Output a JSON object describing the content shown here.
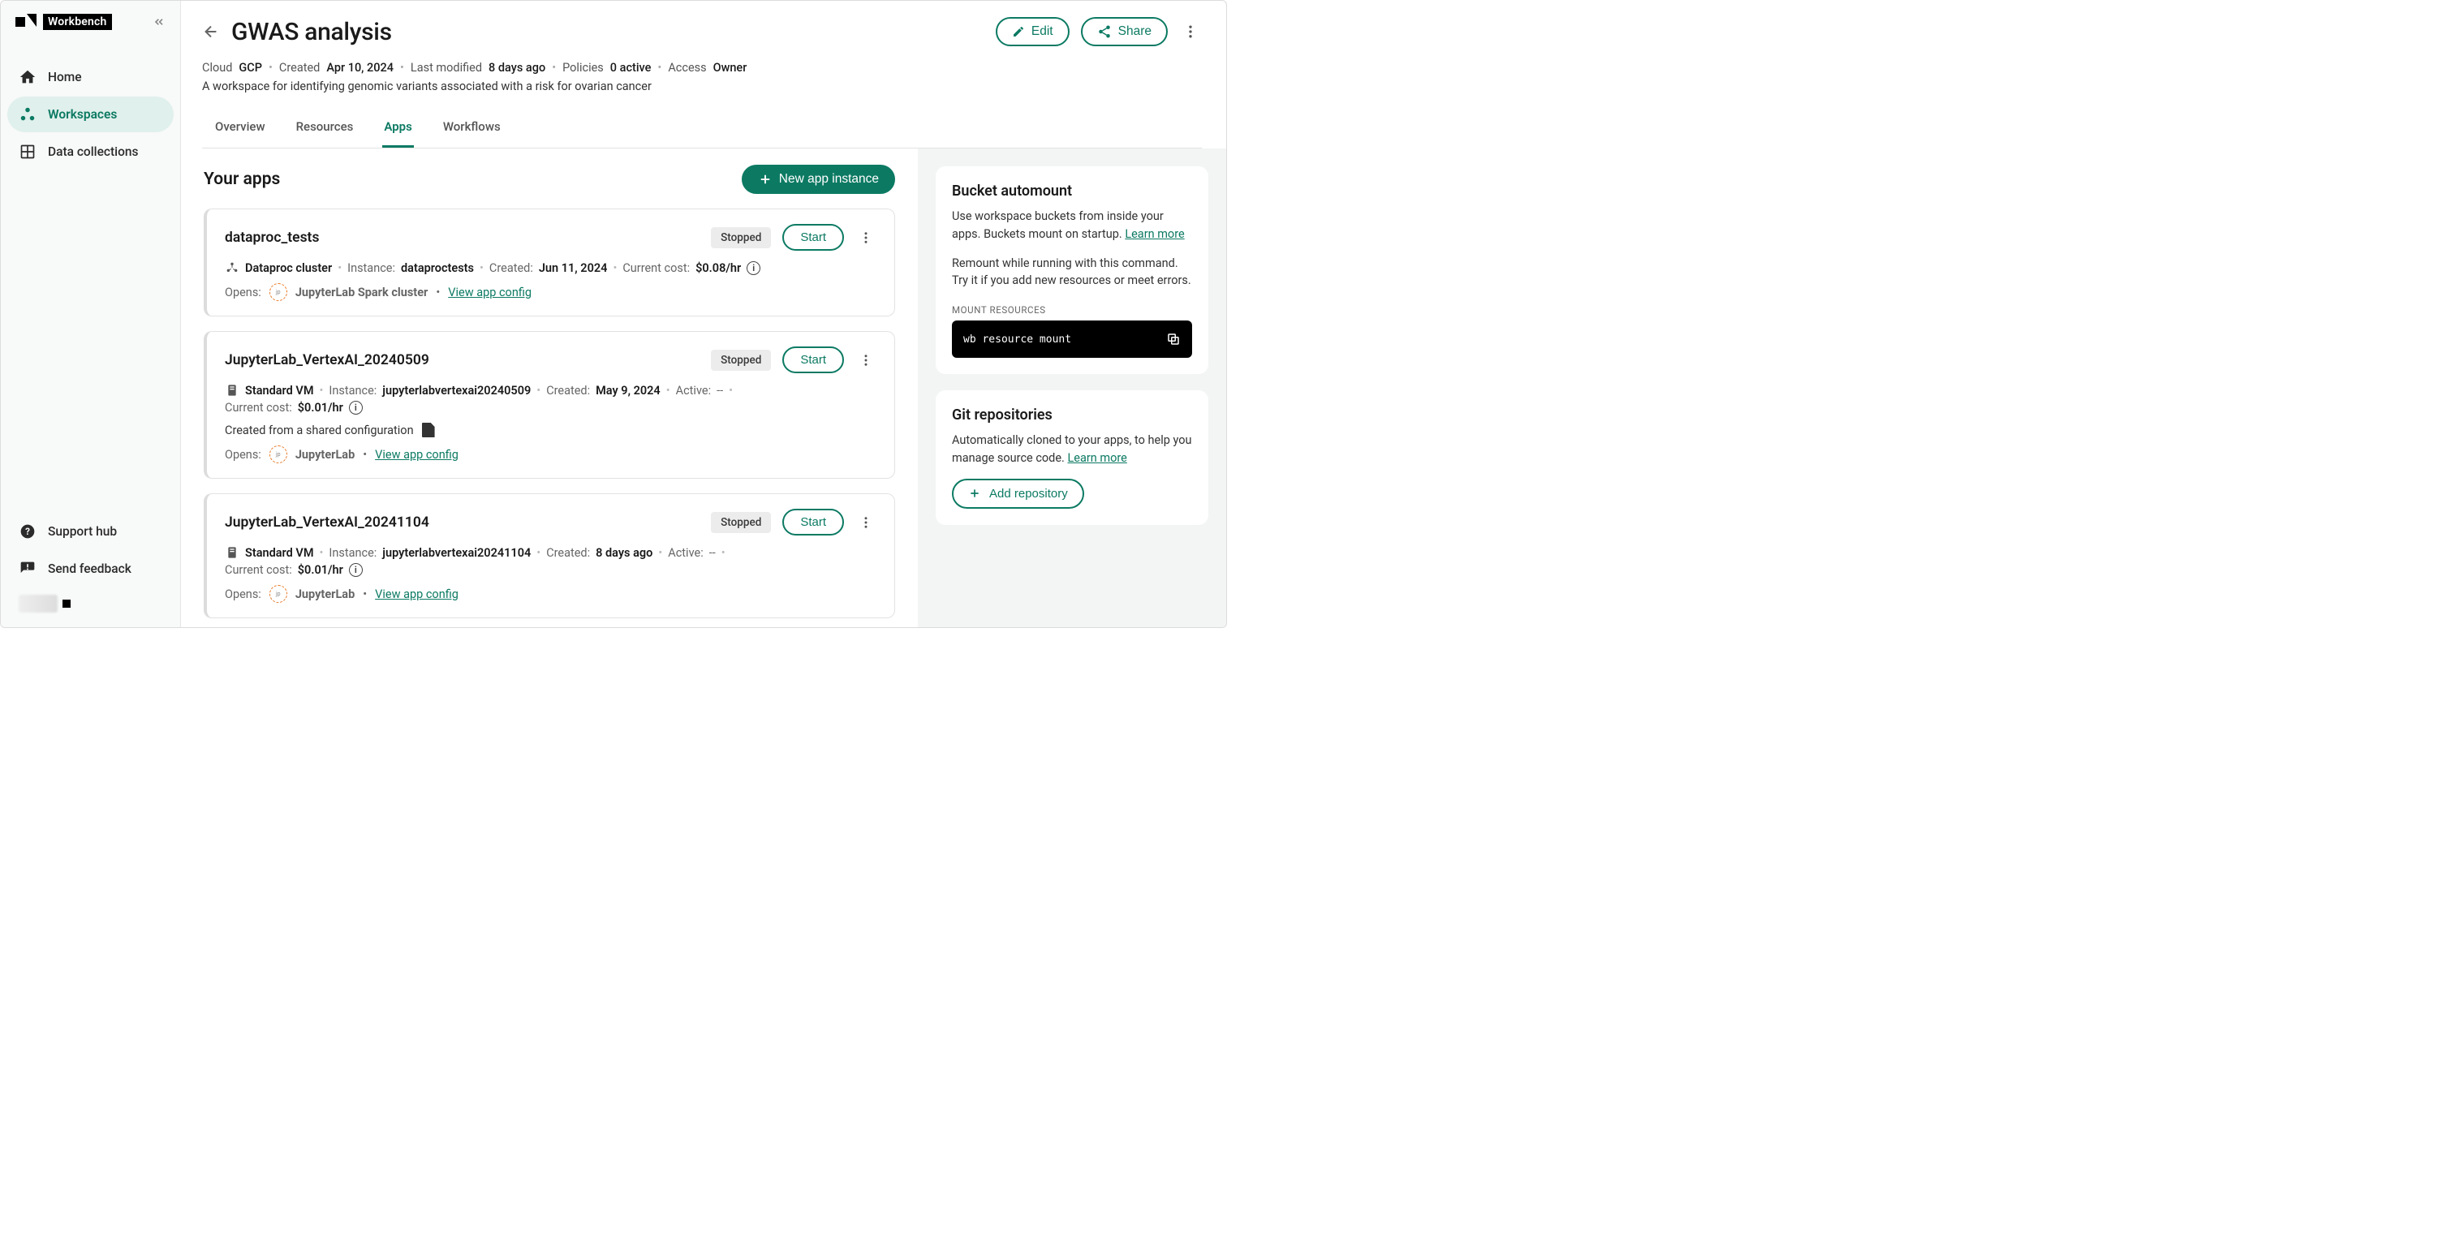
{
  "brand": {
    "name": "Workbench"
  },
  "sidebar": {
    "items": [
      {
        "label": "Home"
      },
      {
        "label": "Workspaces"
      },
      {
        "label": "Data collections"
      }
    ],
    "bottom": [
      {
        "label": "Support hub"
      },
      {
        "label": "Send feedback"
      }
    ]
  },
  "header": {
    "title": "GWAS analysis",
    "cloud_label": "Cloud",
    "cloud_value": "GCP",
    "created_label": "Created",
    "created_value": "Apr 10, 2024",
    "modified_label": "Last modified",
    "modified_value": "8 days ago",
    "policies_label": "Policies",
    "policies_value": "0 active",
    "access_label": "Access",
    "access_value": "Owner",
    "description": "A workspace for identifying genomic variants associated with a risk for ovarian cancer",
    "edit_label": "Edit",
    "share_label": "Share"
  },
  "tabs": {
    "items": [
      {
        "label": "Overview"
      },
      {
        "label": "Resources"
      },
      {
        "label": "Apps"
      },
      {
        "label": "Workflows"
      }
    ]
  },
  "apps": {
    "section_title": "Your apps",
    "new_button": "New app instance",
    "start_label": "Start",
    "stopped_label": "Stopped",
    "instance_label": "Instance:",
    "created_label": "Created:",
    "cost_label": "Current cost:",
    "active_label": "Active:",
    "opens_label": "Opens:",
    "view_config": "View app config",
    "shared_note": "Created from a shared configuration",
    "items": [
      {
        "name": "dataproc_tests",
        "type": "Dataproc cluster",
        "instance": "dataproctests",
        "created": "Jun 11, 2024",
        "cost": "$0.08/hr",
        "opens": "JupyterLab Spark cluster"
      },
      {
        "name": "JupyterLab_VertexAI_20240509",
        "type": "Standard VM",
        "instance": "jupyterlabvertexai20240509",
        "created": "May 9, 2024",
        "active": "--",
        "cost": "$0.01/hr",
        "opens": "JupyterLab"
      },
      {
        "name": "JupyterLab_VertexAI_20241104",
        "type": "Standard VM",
        "instance": "jupyterlabvertexai20241104",
        "created": "8 days ago",
        "active": "--",
        "cost": "$0.01/hr",
        "opens": "JupyterLab"
      }
    ]
  },
  "right": {
    "bucket": {
      "title": "Bucket automount",
      "line1": "Use workspace buckets from inside your apps. Buckets mount on startup.",
      "learn_more": "Learn more",
      "line2": "Remount while running with this command. Try it if you add new resources or meet errors.",
      "code_label": "MOUNT RESOURCES",
      "code": "wb resource mount"
    },
    "git": {
      "title": "Git repositories",
      "line1": "Automatically cloned to your apps, to help you manage source code.",
      "learn_more": "Learn more",
      "add_button": "Add repository"
    }
  }
}
